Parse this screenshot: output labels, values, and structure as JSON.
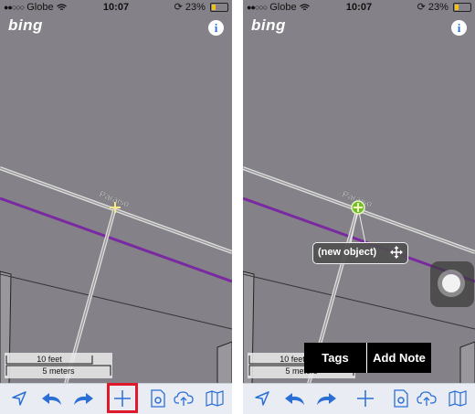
{
  "screens": [
    {
      "status": {
        "signal": "●●○○○",
        "carrier": "Globe",
        "time": "10:07",
        "battery": "23%",
        "battery_level": 0.23
      },
      "map": {
        "logo": "bing",
        "info_icon": "i",
        "street_label": "Paraiso"
      },
      "scale": {
        "feet": "10 feet",
        "meters": "5 meters"
      },
      "toolbar": [
        "location-arrow-icon",
        "undo-icon",
        "redo-icon",
        "add-icon",
        "settings-icon",
        "upload-icon",
        "map-icon"
      ],
      "highlighted_button": "add-icon"
    },
    {
      "status": {
        "signal": "●●○○○",
        "carrier": "Globe",
        "time": "10:07",
        "battery": "23%",
        "battery_level": 0.23
      },
      "map": {
        "logo": "bing",
        "info_icon": "i",
        "street_label": "Paraiso"
      },
      "scale": {
        "feet": "10 feet",
        "meters": "5 meters"
      },
      "callout": {
        "label": "(new object)",
        "icon": "move-icon"
      },
      "menu": {
        "tags": "Tags",
        "add_note": "Add Note"
      },
      "toolbar": [
        "location-arrow-icon",
        "undo-icon",
        "redo-icon",
        "add-icon",
        "settings-icon",
        "upload-icon",
        "map-icon"
      ]
    }
  ],
  "colors": {
    "accent": "#2b6fd6",
    "highlight": "#e0192a",
    "road_purple": "#7a2aa0",
    "node_green": "#6fbf2a"
  }
}
